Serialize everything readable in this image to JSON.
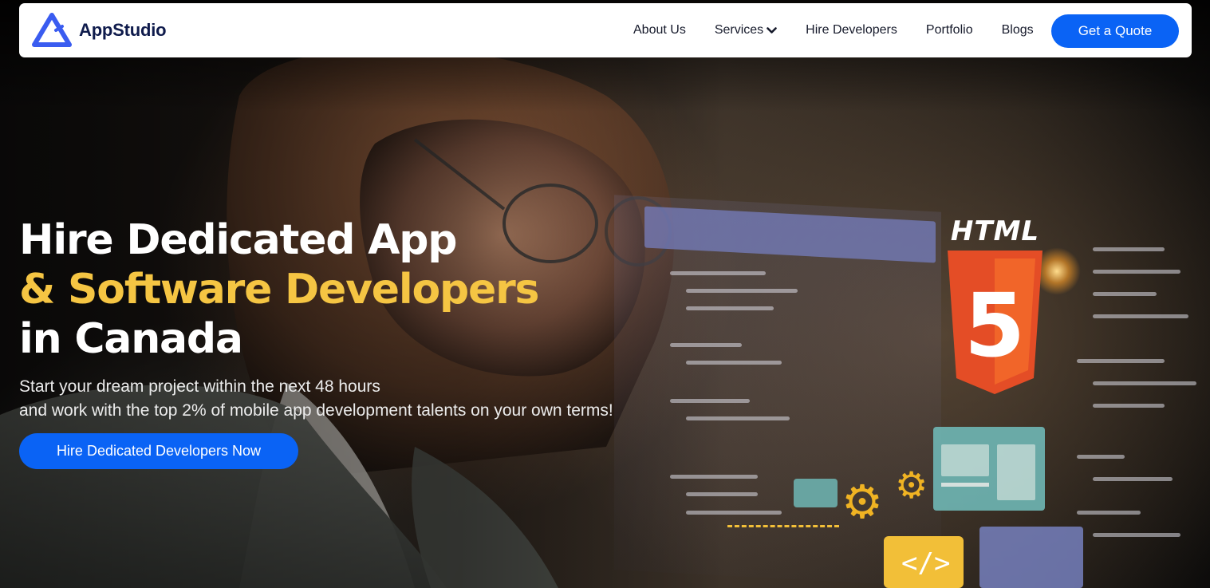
{
  "brand": {
    "name": "AppStudio",
    "logo_icon": "triangle-a-logo-icon",
    "logo_color": "#3a5cf0"
  },
  "nav": {
    "items": [
      {
        "label": "About Us"
      },
      {
        "label": "Services",
        "icon": "chevron-down-icon"
      },
      {
        "label": "Hire Developers"
      },
      {
        "label": "Portfolio"
      },
      {
        "label": "Blogs"
      }
    ],
    "cta_label": "Get a Quote"
  },
  "hero": {
    "headline_line1": "Hire Dedicated App",
    "headline_line2": "& Software Developers",
    "headline_line3": "in Canada",
    "subtext_line1": "Start your dream project within the next 48 hours",
    "subtext_line2": "and work with the top 2% of mobile app development talents on your own terms!",
    "cta_label": "Hire Dedicated Developers Now",
    "badge_text": "HTML",
    "badge_number": "5"
  },
  "colors": {
    "primary_blue": "#0a63f5",
    "accent_yellow": "#f5c543",
    "navbar_bg": "#ffffff",
    "brand_navy": "#0f1b4c",
    "html5_orange": "#e44d26"
  }
}
